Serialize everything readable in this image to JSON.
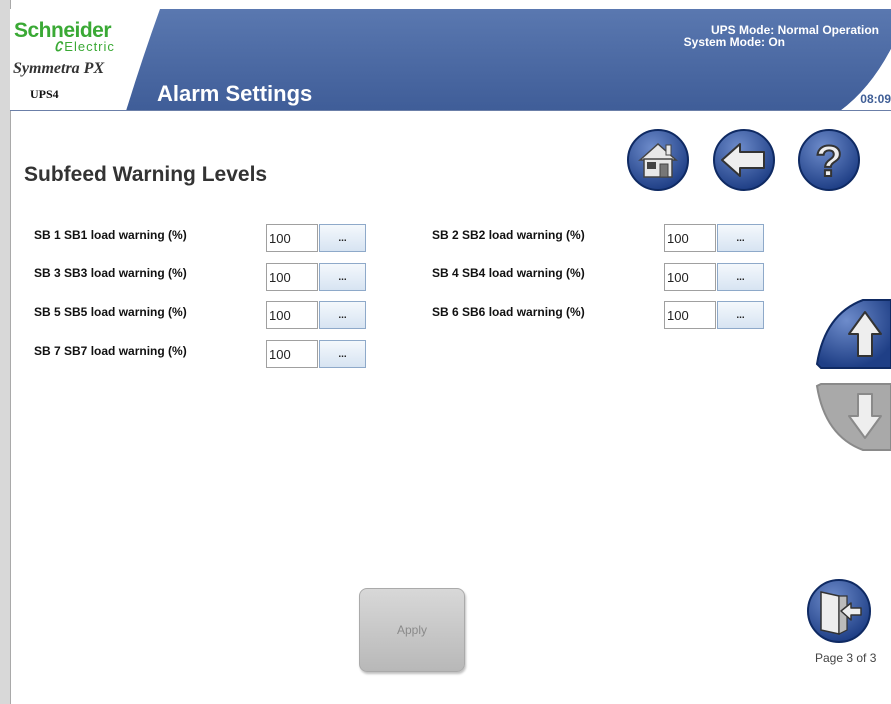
{
  "header": {
    "brand_name": "Schneider",
    "brand_sub": "Electric",
    "product": "Symmetra PX",
    "unit": "UPS4",
    "page_title": "Alarm Settings",
    "ups_mode": "UPS Mode: Normal Operation",
    "system_mode": "System Mode: On",
    "time": "08:09",
    "header_color": "#4a6aa5"
  },
  "main": {
    "title": "Subfeed Warning Levels",
    "browse_label": "...",
    "fields": [
      {
        "label": "SB 1 SB1 load warning (%)",
        "value": "100"
      },
      {
        "label": "SB 2 SB2 load warning (%)",
        "value": "100"
      },
      {
        "label": "SB 3 SB3 load warning (%)",
        "value": "100"
      },
      {
        "label": "SB 4 SB4 load warning (%)",
        "value": "100"
      },
      {
        "label": "SB 5 SB5 load warning (%)",
        "value": "100"
      },
      {
        "label": "SB 6 SB6 load warning (%)",
        "value": "100"
      },
      {
        "label": "SB 7 SB7 load warning (%)",
        "value": "100"
      }
    ],
    "apply_label": "Apply"
  },
  "nav": {
    "home_icon": "home-icon",
    "back_icon": "back-arrow-icon",
    "help_icon": "help-icon",
    "up_icon": "scroll-up-icon",
    "down_icon": "scroll-down-icon",
    "exit_icon": "exit-door-icon",
    "page_info": "Page 3 of 3"
  }
}
